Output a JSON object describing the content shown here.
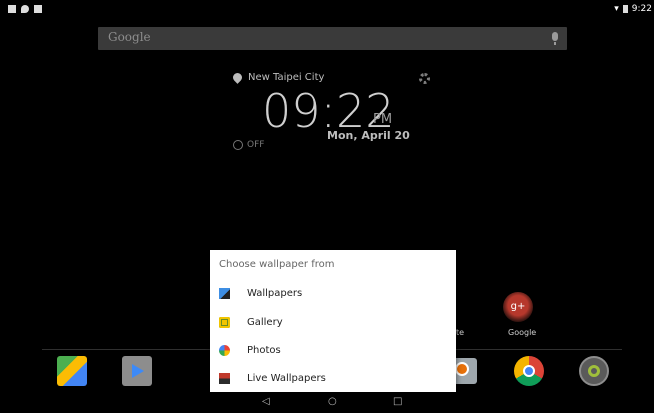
{
  "status_bar": {
    "time": "9:22"
  },
  "search": {
    "logo": "Google"
  },
  "clock_widget": {
    "location": "New Taipei City",
    "time": "09:22",
    "ampm": "PM",
    "date": "Mon, April 20",
    "alarm": "OFF"
  },
  "home": {
    "partial_label": "te",
    "google_folder_label": "Google",
    "gplus_text": "g+"
  },
  "dialog": {
    "title": "Choose wallpaper from",
    "options": [
      {
        "label": "Wallpapers",
        "icon": "wallpapers-icon"
      },
      {
        "label": "Gallery",
        "icon": "gallery-icon"
      },
      {
        "label": "Photos",
        "icon": "photos-icon"
      },
      {
        "label": "Live Wallpapers",
        "icon": "live-wallpapers-icon"
      }
    ]
  },
  "nav": {
    "back": "◁",
    "home": "○",
    "recents": "□"
  }
}
